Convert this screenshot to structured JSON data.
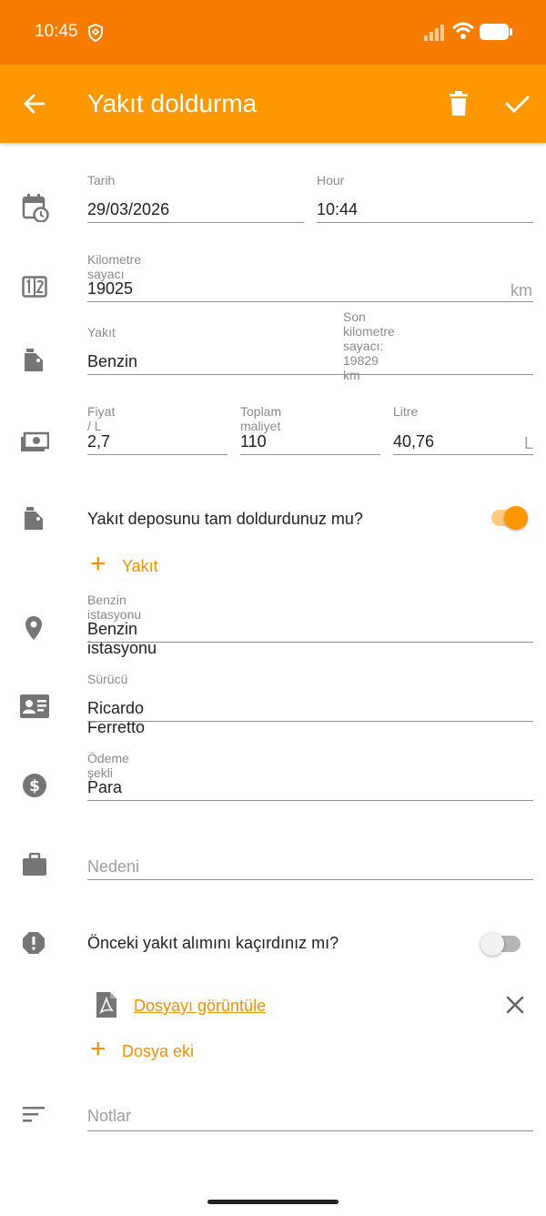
{
  "status_bar": {
    "time": "10:45"
  },
  "app_bar": {
    "title": "Yakıt doldurma"
  },
  "form": {
    "date": {
      "label": "Tarih",
      "value": "29/03/2026"
    },
    "hour": {
      "label": "Hour",
      "value": "10:44"
    },
    "odometer": {
      "label": "Kilometre sayacı",
      "value": "19025",
      "unit": "km",
      "hint": "Son kilometre sayacı: 19829 km"
    },
    "fuel": {
      "label": "Yakıt",
      "value": "Benzin"
    },
    "price": {
      "label": "Fiyat / L",
      "value": "2,7"
    },
    "total_cost": {
      "label": "Toplam maliyet",
      "value": "110"
    },
    "liters": {
      "label": "Litre",
      "value": "40,76",
      "unit": "L"
    },
    "full_tank": {
      "label": "Yakıt deposunu tam doldurdunuz mu?",
      "checked": true
    },
    "add_fuel": {
      "label": "Yakıt"
    },
    "station": {
      "label": "Benzin istasyonu",
      "value": "Benzin istasyonu"
    },
    "driver": {
      "label": "Sürücü",
      "value": "Ricardo Ferretto"
    },
    "payment": {
      "label": "Ödeme şekli",
      "value": "Para"
    },
    "reason": {
      "placeholder": "Nedeni"
    },
    "missed_previous": {
      "label": "Önceki yakıt alımını kaçırdınız mı?",
      "checked": false
    },
    "attachment": {
      "label": "Dosyayı görüntüle"
    },
    "add_attachment": {
      "label": "Dosya eki"
    },
    "notes": {
      "placeholder": "Notlar"
    }
  },
  "colors": {
    "status_bar": "#f57c00",
    "app_bar": "#ff9800",
    "accent": "#f29000",
    "icon_gray": "#757575"
  }
}
